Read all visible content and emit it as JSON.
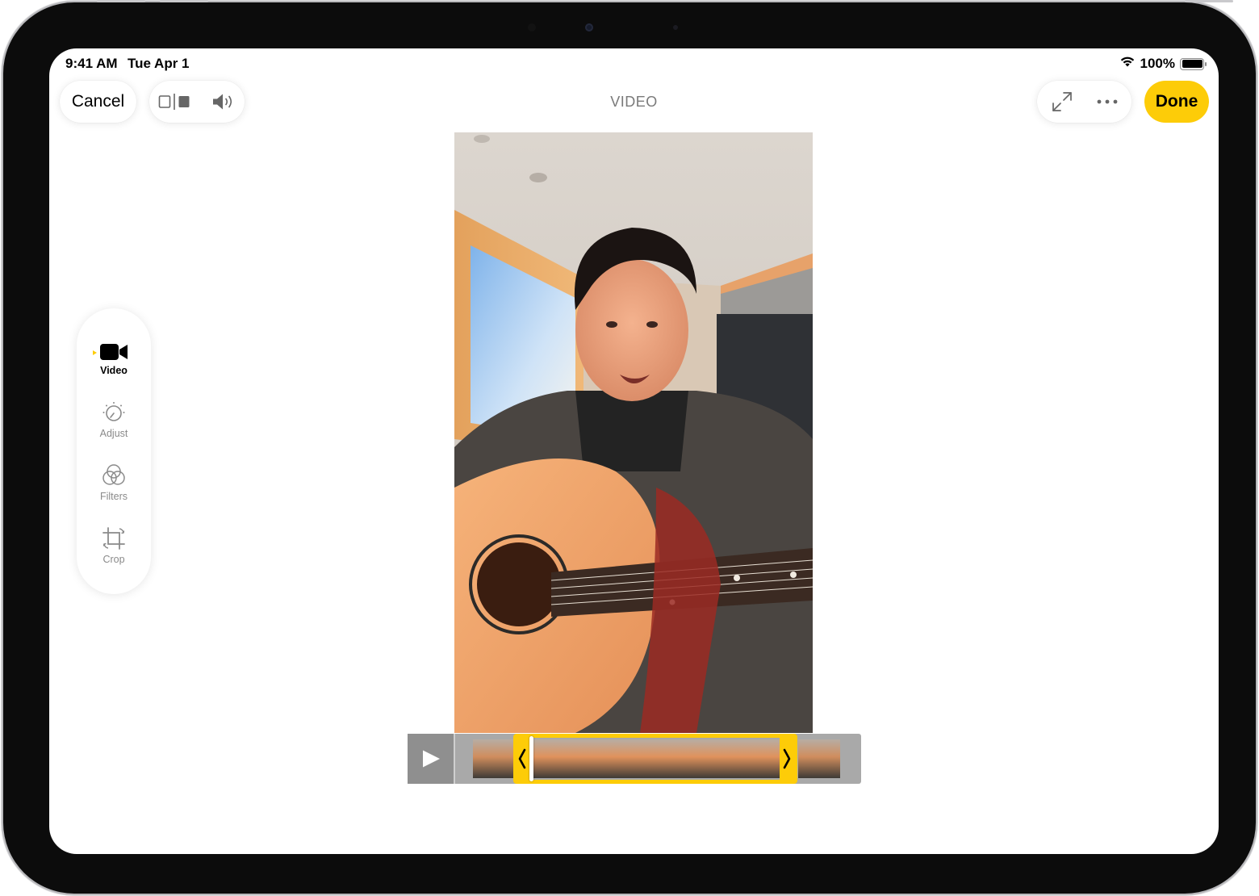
{
  "status_bar": {
    "time": "9:41 AM",
    "date": "Tue Apr 1",
    "battery": "100%"
  },
  "toolbar": {
    "cancel_label": "Cancel",
    "title": "VIDEO",
    "done_label": "Done",
    "icons": [
      "live-compare-icon",
      "speaker-icon",
      "expand-icon",
      "more-icon"
    ]
  },
  "sidebar": {
    "items": [
      {
        "label": "Video",
        "icon": "video-camera-icon",
        "active": true
      },
      {
        "label": "Adjust",
        "icon": "adjust-dial-icon",
        "active": false
      },
      {
        "label": "Filters",
        "icon": "filters-icon",
        "active": false
      },
      {
        "label": "Crop",
        "icon": "crop-icon",
        "active": false
      }
    ]
  },
  "timeline": {
    "play_icon": "play-icon",
    "trim_start_fraction": 0.15,
    "trim_end_fraction": 0.86,
    "playhead_fraction": 0.19
  },
  "colors": {
    "accent": "#fdcc08",
    "title": "#7a7a7a",
    "inactive_label": "#8a8a8a"
  }
}
